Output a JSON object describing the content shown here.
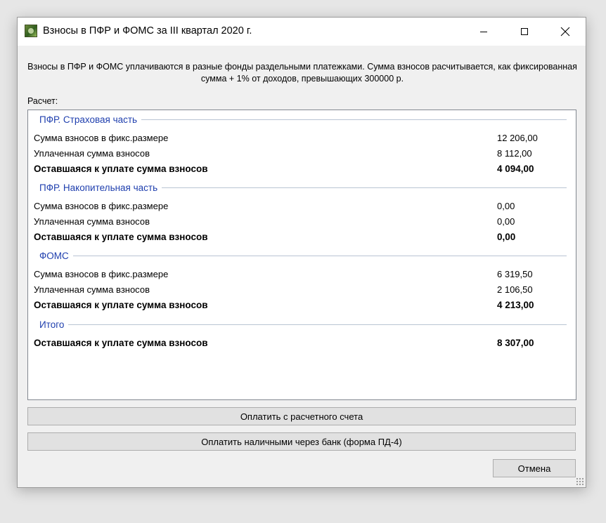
{
  "window": {
    "title": "Взносы в ПФР и ФОМС за III квартал 2020 г."
  },
  "description": "Взносы в ПФР и ФОМС уплачиваются в разные фонды раздельными платежками. Сумма взносов расчитывается, как фиксированная сумма + 1% от доходов, превышающих 300000 р.",
  "calc_label": "Расчет:",
  "sections": [
    {
      "title": "ПФР. Страховая часть",
      "rows": [
        {
          "label": "Сумма взносов в фикс.размере",
          "value": "12 206,00"
        },
        {
          "label": "Уплаченная сумма взносов",
          "value": "8 112,00"
        },
        {
          "label": "Оставшаяся к уплате сумма взносов",
          "value": "4 094,00"
        }
      ]
    },
    {
      "title": "ПФР. Накопительная часть",
      "rows": [
        {
          "label": "Сумма взносов в фикс.размере",
          "value": "0,00"
        },
        {
          "label": "Уплаченная сумма взносов",
          "value": "0,00"
        },
        {
          "label": "Оставшаяся к уплате сумма взносов",
          "value": "0,00"
        }
      ]
    },
    {
      "title": "ФОМС",
      "rows": [
        {
          "label": "Сумма взносов в фикс.размере",
          "value": "6 319,50"
        },
        {
          "label": "Уплаченная сумма взносов",
          "value": "2 106,50"
        },
        {
          "label": "Оставшаяся к уплате сумма взносов",
          "value": "4 213,00"
        }
      ]
    },
    {
      "title": "Итого",
      "rows": [
        {
          "label": "Оставшаяся к уплате сумма взносов",
          "value": "8 307,00"
        }
      ]
    }
  ],
  "buttons": {
    "pay_account": "Оплатить с расчетного счета",
    "pay_cash": "Оплатить наличными через банк (форма ПД-4)",
    "cancel": "Отмена"
  },
  "colors": {
    "section_heading": "#1f3fae",
    "window_background": "#f0f0f0",
    "panel_background": "#ffffff"
  },
  "icons": {
    "app": "app-icon",
    "minimize": "minimize-icon",
    "maximize": "maximize-icon",
    "close": "close-icon"
  }
}
